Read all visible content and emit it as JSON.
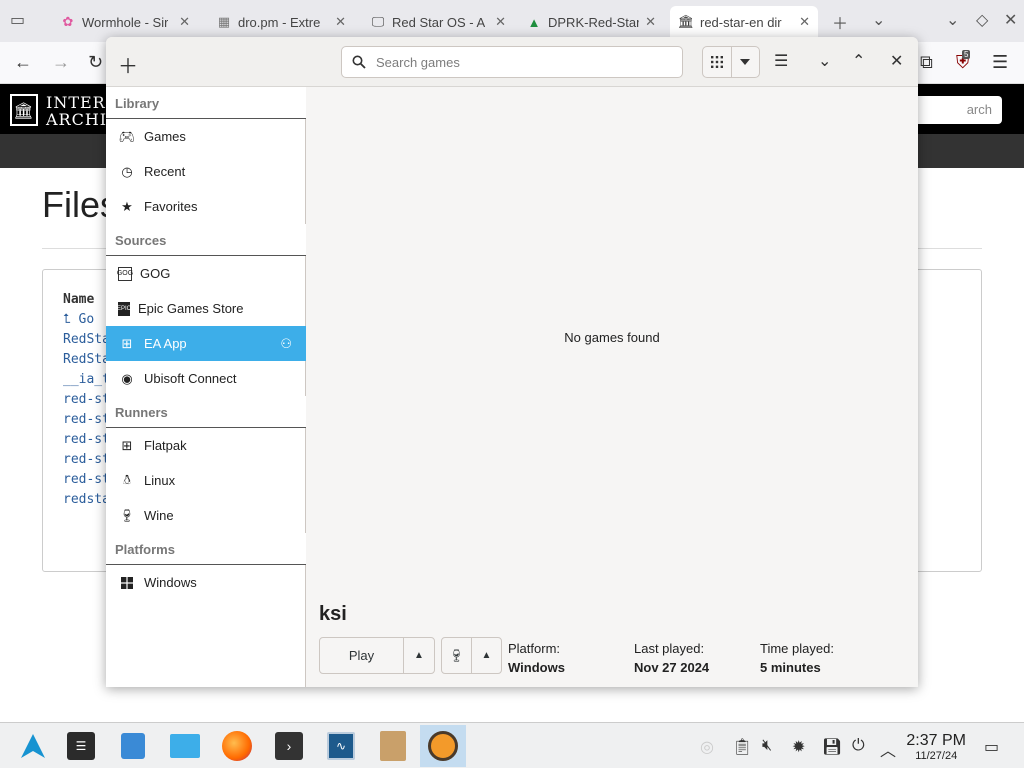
{
  "browser": {
    "tabs": [
      {
        "label": "Wormhole - Sir",
        "icon": "flower-icon"
      },
      {
        "label": "dro.pm - Extre",
        "icon": "page-icon"
      },
      {
        "label": "Red Star OS - A",
        "icon": "monitor-icon"
      },
      {
        "label": "DPRK-Red-Star",
        "icon": "drive-icon"
      },
      {
        "label": "red-star-en dir",
        "icon": "archive-icon"
      }
    ],
    "close_glyph": "✕"
  },
  "archive_page": {
    "logo_line1": "INTER",
    "logo_line2": "ARCHIV",
    "search_placeholder": "arch",
    "files_title": "Files",
    "column_header": "Name",
    "rows": [
      "⮤ Go",
      "RedSta",
      "RedSta",
      "__ia_t",
      "red-st",
      "red-st",
      "red-st",
      "red-st",
      "red-st",
      "redsta"
    ]
  },
  "lutris": {
    "search_placeholder": "Search games",
    "sidebar": {
      "sections": [
        {
          "title": "Library",
          "items": [
            {
              "label": "Games",
              "icon": "gamepad-icon"
            },
            {
              "label": "Recent",
              "icon": "clock-icon"
            },
            {
              "label": "Favorites",
              "icon": "star-icon"
            }
          ]
        },
        {
          "title": "Sources",
          "items": [
            {
              "label": "GOG",
              "icon": "gog-icon"
            },
            {
              "label": "Epic Games Store",
              "icon": "epic-icon"
            },
            {
              "label": "EA App",
              "icon": "ea-icon",
              "selected": true
            },
            {
              "label": "Ubisoft Connect",
              "icon": "ubisoft-icon"
            }
          ]
        },
        {
          "title": "Runners",
          "items": [
            {
              "label": "Flatpak",
              "icon": "flatpak-icon"
            },
            {
              "label": "Linux",
              "icon": "linux-icon"
            },
            {
              "label": "Wine",
              "icon": "wine-icon"
            }
          ]
        },
        {
          "title": "Platforms",
          "items": [
            {
              "label": "Windows",
              "icon": "windows-icon"
            }
          ]
        }
      ]
    },
    "empty_message": "No games found",
    "game": {
      "title": "ksi",
      "play_label": "Play",
      "platform_label": "Platform:",
      "platform_value": "Windows",
      "last_played_label": "Last played:",
      "last_played_value": "Nov 27 2024",
      "time_played_label": "Time played:",
      "time_played_value": "5 minutes"
    }
  },
  "taskbar": {
    "time": "2:37 PM",
    "date": "11/27/24",
    "badge_count": "5"
  },
  "colors": {
    "selection": "#3daee9",
    "archive_header": "#000000",
    "link": "#2b5d9b"
  }
}
